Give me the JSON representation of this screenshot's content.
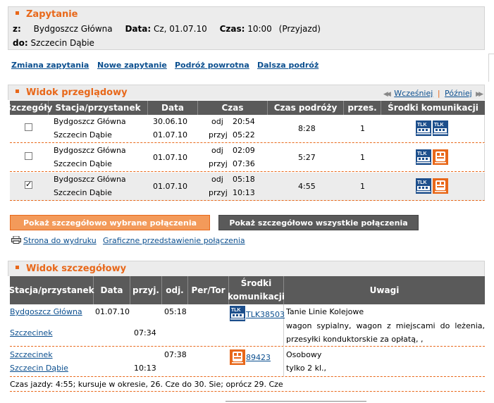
{
  "query": {
    "title": "Zapytanie",
    "from_label": "z:",
    "from_value": "Bydgoszcz Główna",
    "date_label": "Data:",
    "date_value": "Cz, 01.07.10",
    "time_label": "Czas:",
    "time_value": "10:00",
    "time_mode": "(Przyjazd)",
    "to_label": "do:",
    "to_value": "Szczecin Dąbie"
  },
  "actions": [
    "Zmiana zapytania",
    "Nowe zapytanie",
    "Podróż powrotna",
    "Dalsza podróż"
  ],
  "overview": {
    "title": "Widok przeglądowy",
    "earlier": "Wcześniej",
    "later": "Później",
    "separator": "|",
    "headers": [
      "Szczegóły",
      "Stacja/przystanek",
      "Data",
      "Czas",
      "Czas podróży",
      "przes.",
      "Środki komunikacji"
    ],
    "rows": [
      {
        "checked": false,
        "from": "Bydgoszcz Główna",
        "to": "Szczecin Dąbie",
        "date1": "30.06.10",
        "date2": "01.07.10",
        "dep_label": "odj",
        "dep": "20:54",
        "arr_label": "przyj",
        "arr": "05:22",
        "duration": "8:28",
        "changes": "1",
        "icons": [
          "tlk-icon",
          "tlk-icon"
        ]
      },
      {
        "checked": false,
        "from": "Bydgoszcz Główna",
        "to": "Szczecin Dąbie",
        "date1": "",
        "date2": "01.07.10",
        "dep_label": "odj",
        "dep": "02:09",
        "arr_label": "przyj",
        "arr": "07:36",
        "duration": "5:27",
        "changes": "1",
        "icons": [
          "tlk-icon",
          "regional-train-icon"
        ]
      },
      {
        "checked": true,
        "from": "Bydgoszcz Główna",
        "to": "Szczecin Dąbie",
        "date1": "",
        "date2": "01.07.10",
        "dep_label": "odj",
        "dep": "05:18",
        "arr_label": "przyj",
        "arr": "10:13",
        "duration": "4:55",
        "changes": "1",
        "icons": [
          "tlk-icon",
          "regional-train-icon"
        ]
      }
    ],
    "btn_selected": "Pokaż szczegółowo wybrane połączenia",
    "btn_all": "Pokaż szczegółowo wszystkie połączenia",
    "print_link": "Strona do wydruku",
    "graphic_link": "Graficzne przedstawienie połączenia"
  },
  "detail": {
    "title": "Widok szczegółowy",
    "headers": [
      "Stacja/przystanek",
      "Data",
      "przyj.",
      "odj.",
      "Per/Tor",
      "Środki komunikacji",
      "Uwagi"
    ],
    "seg1": {
      "from": "Bydgoszcz Główna",
      "date": "01.07.10",
      "dep": "05:18",
      "to": "Szczecinek",
      "arr": "07:34",
      "train": "TLK38503",
      "notes": [
        "Tanie Linie Kolejowe",
        "wagon sypialny, wagon z miejscami do leżenia,",
        "przesyłki konduktorskie za opłatą, ,"
      ]
    },
    "seg2": {
      "from": "Szczecinek",
      "dep": "07:38",
      "to": "Szczecin Dąbie",
      "arr": "10:13",
      "train": "89423",
      "notes": [
        "Osobowy",
        "tylko 2 kl.,"
      ]
    },
    "footer": "Czas jazdy: 4:55; kursuje w okresie, 26. Cze do 30. Sie; oprócz 29. Cze"
  },
  "colors": {
    "accent": "#e8681a",
    "header_bg": "#5a5a5a",
    "selected_row": "#ececec",
    "link": "#0b4f8f",
    "tlk_blue": "#1d4f8c"
  }
}
